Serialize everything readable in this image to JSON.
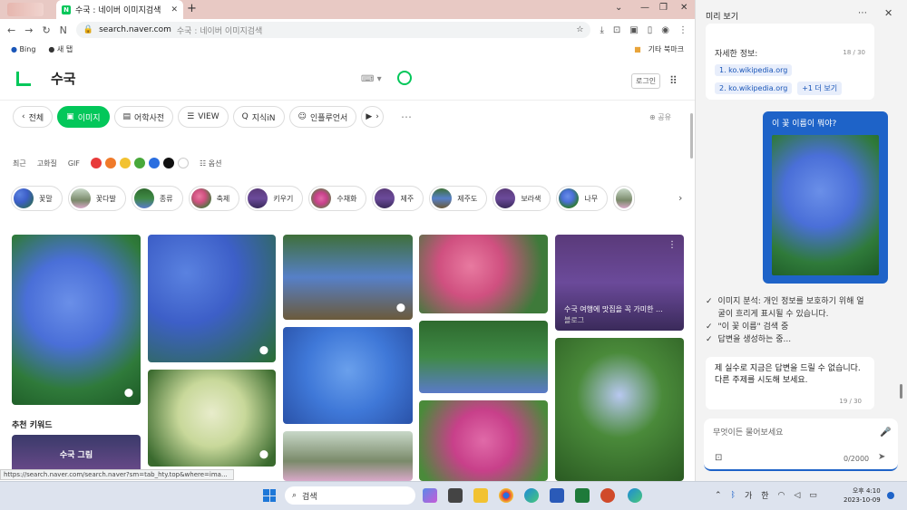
{
  "browser": {
    "tab_title": "수국 : 네이버 이미지검색",
    "tab_favicon": "N",
    "url": "search.naver.com",
    "url_title": "수국 : 네이버 이미지검색",
    "bookmarks": [
      "Bing",
      "새 탭"
    ],
    "bookmarks_right": [
      "기타 북마크"
    ]
  },
  "naver": {
    "query": "수국",
    "login_label": "로그인",
    "tabs": [
      "전체",
      "이미지",
      "어학사전",
      "VIEW",
      "지식iN",
      "인플루언서"
    ],
    "active_tab": "이미지",
    "share_label": "공유",
    "filters": [
      "최근",
      "고화질",
      "GIF"
    ],
    "colors": [
      "#e83a3a",
      "#f07a2a",
      "#f2c231",
      "#48a83a",
      "#2a6ee0",
      "#111111",
      "#ffffff"
    ],
    "options_label": "옵션",
    "categories": [
      "꽃말",
      "꽃다발",
      "종류",
      "축제",
      "키우기",
      "수채화",
      "제주",
      "제주도",
      "보라색",
      "나무"
    ],
    "image_caption": "수국 여행에 맛집을 꼭 가미한 ...",
    "image_source": "블로그",
    "recommended_keywords_title": "추천 키워드",
    "keyword_card": "수국 그림",
    "status_url": "https://search.naver.com/search.naver?sm=tab_hty.top&where=ima..."
  },
  "copilot": {
    "panel_title": "미리 보기",
    "detail_label": "자세한 정보:",
    "detail_count": "18 / 30",
    "sources": [
      "1. ko.wikipedia.org",
      "2. ko.wikipedia.org",
      "+1 더 보기"
    ],
    "user_message": "이 꽃 이름이 뭐야?",
    "steps": [
      "이미지 분석: 개인 정보를 보호하기 위해 얼굴이 흐리게 표시될 수 있습니다.",
      "\"이 꽃 이름\" 검색 중",
      "답변을 생성하는 중..."
    ],
    "reply": "제 실수로 지금은 답변을 드릴 수 없습니다. 다른 주제를 시도해 보세요.",
    "reply_count": "19 / 30",
    "input_placeholder": "무엇이든 물어보세요",
    "char_counter": "0/2000"
  },
  "taskbar": {
    "search_label": "검색",
    "tray_lang1": "가",
    "tray_lang2": "한",
    "time": "오후 4:10",
    "date": "2023-10-09"
  }
}
